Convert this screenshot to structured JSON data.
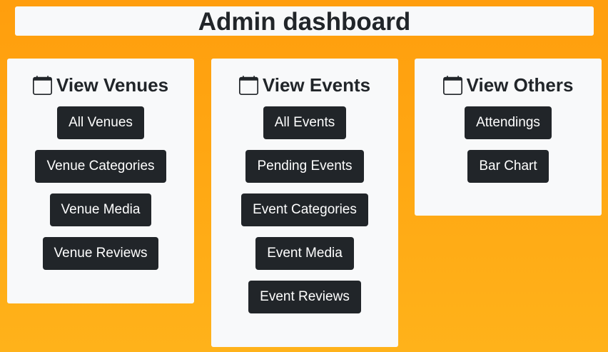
{
  "header": {
    "title": "Admin dashboard"
  },
  "cards": [
    {
      "title": "View Venues",
      "icon": "calendar-icon",
      "buttons": [
        "All Venues",
        "Venue Categories",
        "Venue Media",
        "Venue Reviews"
      ]
    },
    {
      "title": "View Events",
      "icon": "calendar-icon",
      "buttons": [
        "All Events",
        "Pending Events",
        "Event Categories",
        "Event Media",
        "Event Reviews"
      ]
    },
    {
      "title": "View Others",
      "icon": "calendar-icon",
      "buttons": [
        "Attendings",
        "Bar Chart"
      ]
    }
  ],
  "colors": {
    "background": "#ffa510",
    "panel": "#f8f9fa",
    "button": "#212529",
    "button_text": "#ffffff"
  }
}
